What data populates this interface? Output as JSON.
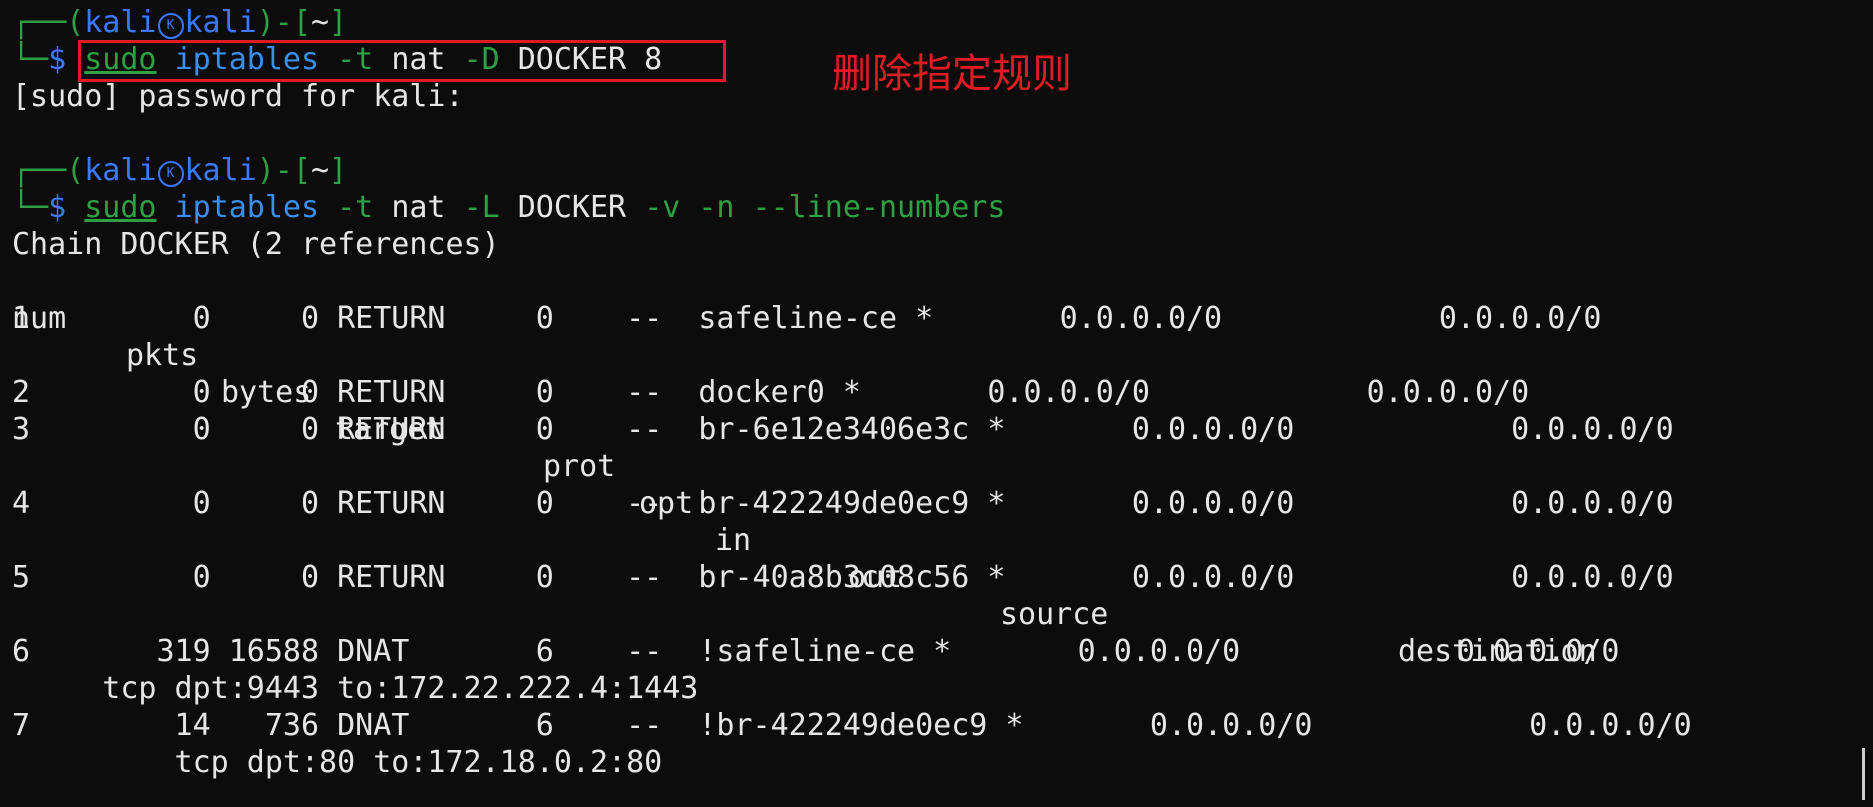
{
  "prompt": {
    "user": "kali",
    "host": "kali",
    "dir": "~",
    "symbol": "$"
  },
  "commands": [
    {
      "sudo": "sudo",
      "bin": "iptables",
      "f1": "-t",
      "a1": "nat",
      "f2": "-D",
      "a2": "DOCKER 8"
    },
    {
      "sudo": "sudo",
      "bin": "iptables",
      "f1": "-t",
      "a1": "nat",
      "f2": "-L",
      "a2": "DOCKER",
      "f3": "-v -n --line-numbers"
    }
  ],
  "sudo_prompt": "[sudo] password for kali:",
  "annotation": "删除指定规则",
  "chain_header": "Chain DOCKER (2 references)",
  "table": {
    "headers": [
      "num",
      "pkts",
      "bytes",
      "target",
      "prot",
      "opt",
      "in",
      "out",
      "source",
      "destination"
    ],
    "rows": [
      {
        "text": "1         0     0 RETURN     0    --  safeline-ce *       0.0.0.0/0            0.0.0.0/0"
      },
      {
        "text": "2         0     0 RETURN     0    --  docker0 *       0.0.0.0/0            0.0.0.0/0"
      },
      {
        "text": "3         0     0 RETURN     0    --  br-6e12e3406e3c *       0.0.0.0/0            0.0.0.0/0"
      },
      {
        "text": "4         0     0 RETURN     0    --  br-422249de0ec9 *       0.0.0.0/0            0.0.0.0/0"
      },
      {
        "text": "5         0     0 RETURN     0    --  br-40a8b3c08c56 *       0.0.0.0/0            0.0.0.0/0"
      },
      {
        "text": "6       319 16588 DNAT       6    --  !safeline-ce *       0.0.0.0/0            0.0.0.0/0",
        "extra": "     tcp dpt:9443 to:172.22.222.4:1443"
      },
      {
        "text": "7        14   736 DNAT       6    --  !br-422249de0ec9 *       0.0.0.0/0            0.0.0.0/0",
        "extra": "         tcp dpt:80 to:172.18.0.2:80"
      }
    ]
  },
  "colors": {
    "background": "#0c0c0c",
    "prompt_green": "#2ea043",
    "prompt_blue": "#3b78ff",
    "annotation_red": "#e01b24"
  }
}
